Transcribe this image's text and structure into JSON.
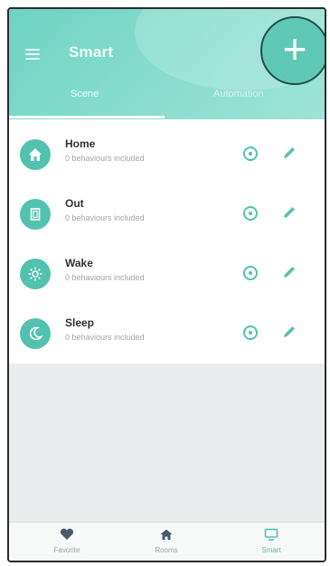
{
  "header": {
    "title": "Smart",
    "tabs": [
      {
        "label": "Scene"
      },
      {
        "label": "Automation"
      }
    ],
    "add_label": "+"
  },
  "scenes": [
    {
      "name": "Home",
      "subtitle": "0 behaviours included",
      "icon": "home-icon"
    },
    {
      "name": "Out",
      "subtitle": "0 behaviours included",
      "icon": "door-icon"
    },
    {
      "name": "Wake",
      "subtitle": "0 behaviours included",
      "icon": "sun-gear-icon"
    },
    {
      "name": "Sleep",
      "subtitle": "0 behaviours included",
      "icon": "moon-icon"
    }
  ],
  "nav": [
    {
      "label": "Favorite",
      "icon": "heart-icon"
    },
    {
      "label": "Rooms",
      "icon": "house-icon"
    },
    {
      "label": "Smart",
      "icon": "monitor-icon"
    }
  ],
  "colors": {
    "accent": "#52c2ae",
    "header": "#7fd9c8"
  }
}
